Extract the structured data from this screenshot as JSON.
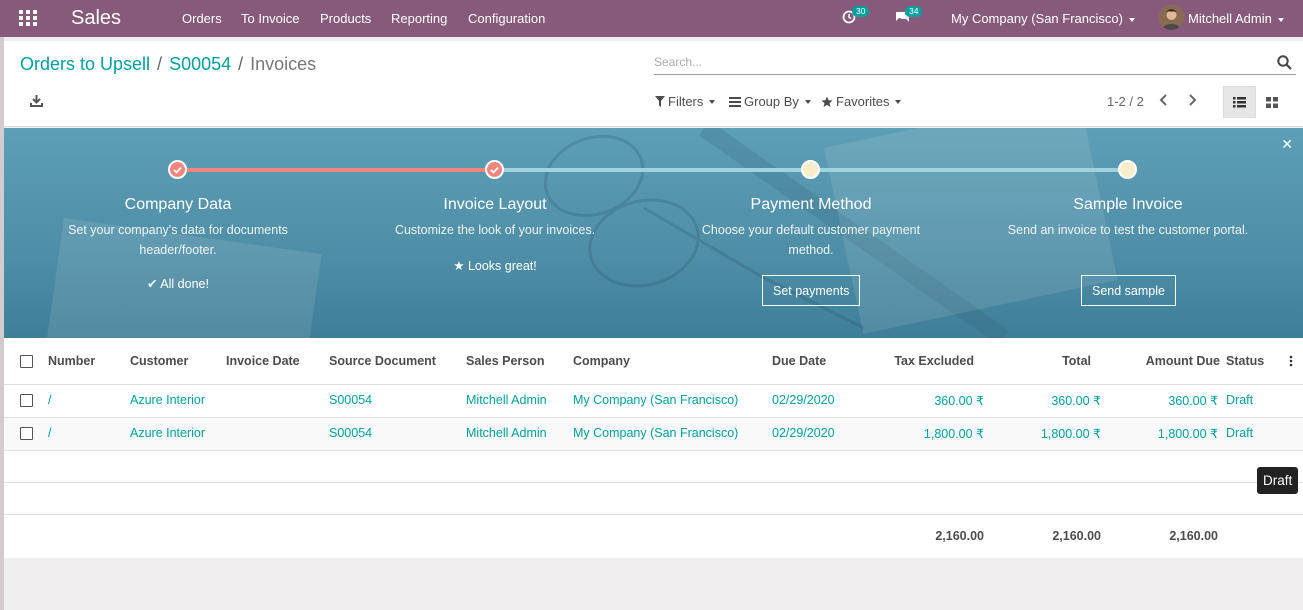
{
  "app": {
    "title": "Sales"
  },
  "menu": [
    "Orders",
    "To Invoice",
    "Products",
    "Reporting",
    "Configuration"
  ],
  "systray": {
    "activity_count": "30",
    "messages_count": "34",
    "company": "My Company (San Francisco)",
    "user": "Mitchell Admin"
  },
  "breadcrumb": {
    "items": [
      "Orders to Upsell",
      "S00054"
    ],
    "current": "Invoices"
  },
  "search": {
    "placeholder": "Search..."
  },
  "filters": {
    "filters": "Filters",
    "group_by": "Group By",
    "favorites": "Favorites"
  },
  "pager": {
    "value": "1-2 / 2"
  },
  "onboarding": {
    "steps": [
      {
        "title": "Company Data",
        "desc": "Set your company's data for documents header/footer.",
        "status": "All done!",
        "state": "done"
      },
      {
        "title": "Invoice Layout",
        "desc": "Customize the look of your invoices.",
        "status": "Looks great!",
        "state": "done"
      },
      {
        "title": "Payment Method",
        "desc": "Choose your default customer payment method.",
        "button": "Set payments",
        "state": "todo"
      },
      {
        "title": "Sample Invoice",
        "desc": "Send an invoice to test the customer portal.",
        "button": "Send sample",
        "state": "todo"
      }
    ]
  },
  "table": {
    "columns": [
      "Number",
      "Customer",
      "Invoice Date",
      "Source Document",
      "Sales Person",
      "Company",
      "Due Date",
      "Tax Excluded",
      "Total",
      "Amount Due",
      "Status"
    ],
    "rows": [
      {
        "number": "/",
        "customer": "Azure Interior",
        "invoice_date": "",
        "source": "S00054",
        "salesperson": "Mitchell Admin",
        "company": "My Company (San Francisco)",
        "due_date": "02/29/2020",
        "tax_excluded": "360.00 ₹",
        "total": "360.00 ₹",
        "amount_due": "360.00 ₹",
        "status": "Draft"
      },
      {
        "number": "/",
        "customer": "Azure Interior",
        "invoice_date": "",
        "source": "S00054",
        "salesperson": "Mitchell Admin",
        "company": "My Company (San Francisco)",
        "due_date": "02/29/2020",
        "tax_excluded": "1,800.00 ₹",
        "total": "1,800.00 ₹",
        "amount_due": "1,800.00 ₹",
        "status": "Draft"
      }
    ],
    "totals": {
      "tax_excluded": "2,160.00",
      "total": "2,160.00",
      "amount_due": "2,160.00"
    }
  },
  "tooltip": "Draft",
  "colors": {
    "brand": "#875a7b",
    "link": "#00a09d",
    "step_done": "#f0857e",
    "step_todo": "#f9eecb"
  }
}
